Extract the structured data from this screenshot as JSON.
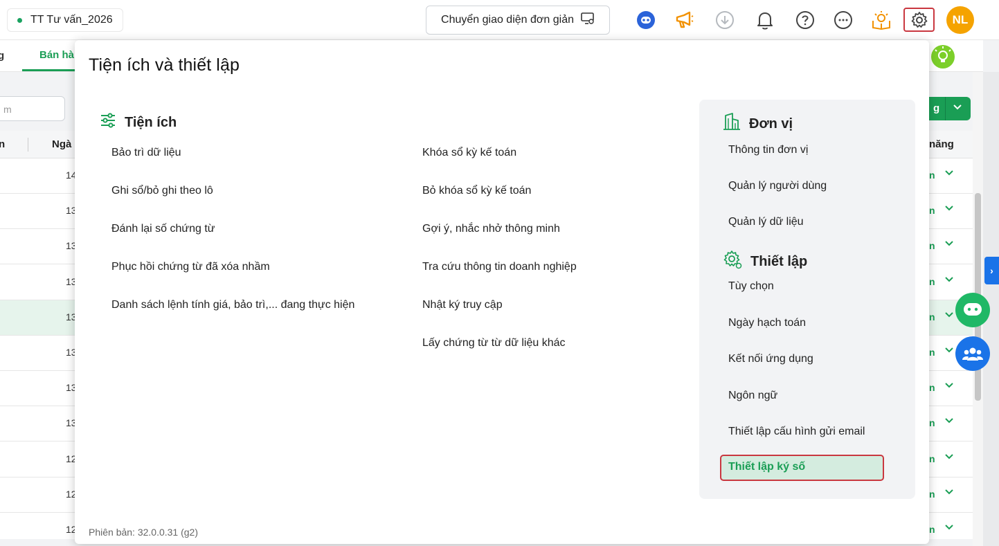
{
  "topbar": {
    "unit_name": "TT Tư vấn_2026",
    "simple_mode_label": "Chuyển giao diện đơn giản",
    "avatar_initials": "NL",
    "colors": {
      "accent": "#1a9e55",
      "avatar": "#f5a300",
      "highlight_border": "#c9373f"
    }
  },
  "background": {
    "tab_partial": "g",
    "tab_active": "Bán hà",
    "search_placeholder": "m",
    "header_col1": "n",
    "header_col2": "Ngà",
    "header_right": "năng",
    "btn_partial": "g",
    "rows": [
      {
        "num": "14",
        "link": "n"
      },
      {
        "num": "13",
        "link": "n"
      },
      {
        "num": "13",
        "link": "n"
      },
      {
        "num": "13",
        "link": "n"
      },
      {
        "num": "13",
        "link": "n"
      },
      {
        "num": "13",
        "link": "n"
      },
      {
        "num": "13",
        "link": "n"
      },
      {
        "num": "13",
        "link": "n"
      },
      {
        "num": "12",
        "link": "n"
      },
      {
        "num": "12",
        "link": "n"
      },
      {
        "num": "12",
        "link": "n"
      }
    ]
  },
  "modal": {
    "title": "Tiện ích và thiết lập",
    "utilities_heading": "Tiện ích",
    "utilities_col1": [
      "Bảo trì dữ liệu",
      "Ghi sổ/bỏ ghi theo lô",
      "Đánh lại số chứng từ",
      "Phục hồi chứng từ đã xóa nhầm",
      "Danh sách lệnh tính giá, bảo trì,... đang thực hiện"
    ],
    "utilities_col2": [
      "Khóa sổ kỳ kế toán",
      "Bỏ khóa sổ kỳ kế toán",
      "Gợi ý, nhắc nhở thông minh",
      "Tra cứu thông tin doanh nghiệp",
      "Nhật ký truy cập",
      "Lấy chứng từ từ dữ liệu khác"
    ],
    "unit_heading": "Đơn vị",
    "unit_items": [
      "Thông tin đơn vị",
      "Quản lý người dùng",
      "Quản lý dữ liệu"
    ],
    "settings_heading": "Thiết lập",
    "settings_items": [
      "Tùy chọn",
      "Ngày hạch toán",
      "Kết nối ứng dụng",
      "Ngôn ngữ",
      "Thiết lập cấu hình gửi email"
    ],
    "settings_active_item": "Thiết lập ký số",
    "version": "Phiên bản: 32.0.0.31 (g2)"
  }
}
